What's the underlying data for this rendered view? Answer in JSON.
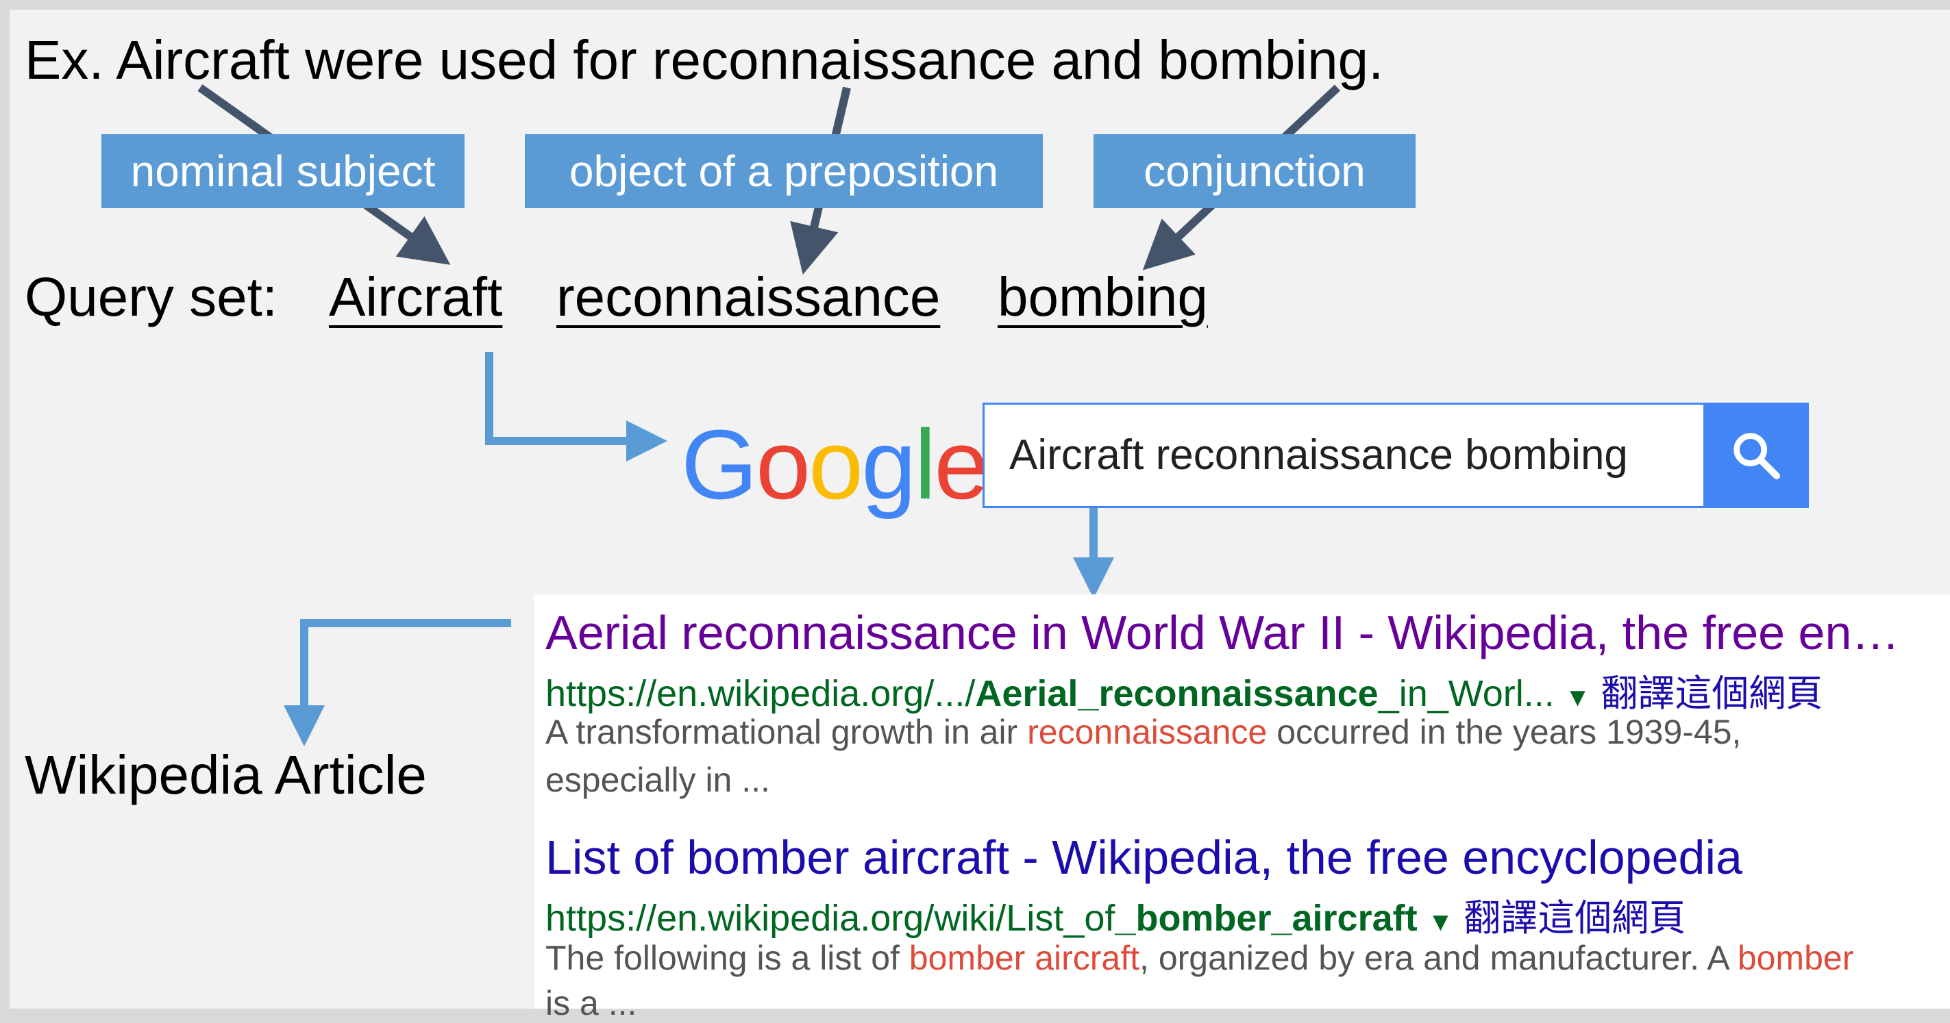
{
  "example_prefix": "Ex.",
  "example_sentence": "Aircraft were used for reconnaissance and bombing.",
  "labels": {
    "nominal_subject": "nominal subject",
    "object_of_preposition": "object of a preposition",
    "conjunction": "conjunction"
  },
  "query_set": {
    "label": "Query set:",
    "words": [
      "Aircraft",
      "reconnaissance",
      "bombing"
    ]
  },
  "google": {
    "logo_letters": [
      "G",
      "o",
      "o",
      "g",
      "l",
      "e"
    ],
    "logo_colors": [
      "#4285f4",
      "#ea4335",
      "#fbbc05",
      "#4285f4",
      "#34a853",
      "#ea4335"
    ],
    "search_query": "Aircraft reconnaissance bombing",
    "search_icon": "magnifier-icon"
  },
  "output_label": "Wikipedia Article",
  "results": [
    {
      "title": "Aerial reconnaissance in World War II - Wikipedia, the free en…",
      "title_color": "#609",
      "url_prefix": "https://en.wikipedia.org/.../",
      "url_bold": "Aerial_reconnaissance",
      "url_suffix": "_in_Worl...",
      "translate": "翻譯這個網頁",
      "snippet_line1_pre": "A transformational growth in air ",
      "snippet_line1_hl": "reconnaissance",
      "snippet_line1_post": " occurred in the years 1939-45,",
      "snippet_line2": "especially in ..."
    },
    {
      "title": "List of bomber aircraft - Wikipedia, the free encyclopedia",
      "title_color": "#1a0dab",
      "url_prefix": "https://en.wikipedia.org/wiki/List_of",
      "url_bold": "_bomber_aircraft",
      "url_suffix": "",
      "translate": "翻譯這個網頁",
      "snippet_line1_pre": "The following is a list of ",
      "snippet_line1_hl": "bomber aircraft",
      "snippet_line1_mid": ", organized by era and manufacturer. A ",
      "snippet_line1_hl2": "bomber",
      "snippet_line2": "is a ..."
    }
  ],
  "colors": {
    "label_fill": "#5b9bd5",
    "arrow_dark": "#44546a",
    "arrow_blue": "#5b9bd5",
    "search_blue": "#4285f4"
  }
}
